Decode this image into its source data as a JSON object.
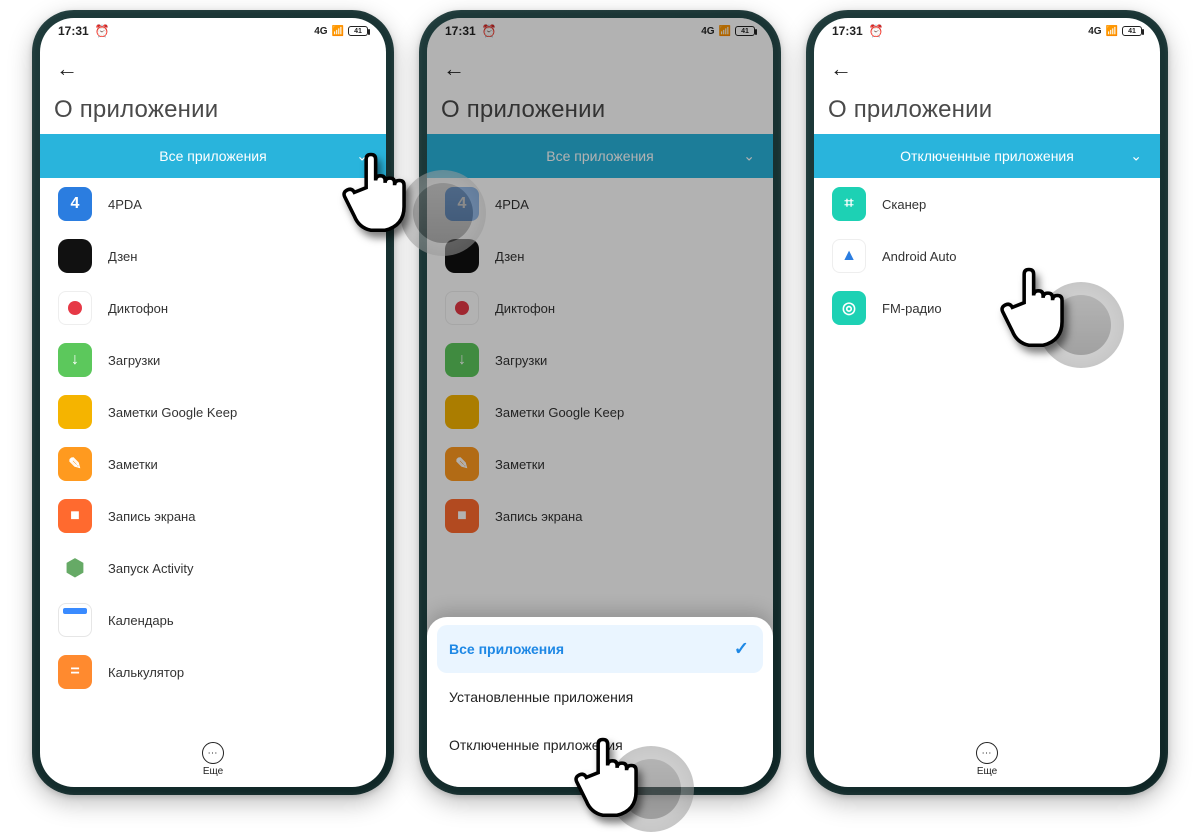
{
  "status": {
    "time": "17:31",
    "battery": "41",
    "network": "4G"
  },
  "header": {
    "title": "О приложении"
  },
  "filter": {
    "all": "Все приложения",
    "disabled": "Отключенные приложения"
  },
  "apps_all": [
    {
      "name": "4PDA",
      "icon": "ic-4pda",
      "glyph": "4"
    },
    {
      "name": "Дзен",
      "icon": "ic-dzen",
      "glyph": ""
    },
    {
      "name": "Диктофон",
      "icon": "ic-dict",
      "glyph": ""
    },
    {
      "name": "Загрузки",
      "icon": "ic-down",
      "glyph": "↓"
    },
    {
      "name": "Заметки Google Keep",
      "icon": "ic-keep",
      "glyph": ""
    },
    {
      "name": "Заметки",
      "icon": "ic-notes",
      "glyph": "✎"
    },
    {
      "name": "Запись экрана",
      "icon": "ic-rec",
      "glyph": "■"
    },
    {
      "name": "Запуск Activity",
      "icon": "ic-activity",
      "glyph": "⬢"
    },
    {
      "name": "Календарь",
      "icon": "ic-cal",
      "glyph": ""
    },
    {
      "name": "Калькулятор",
      "icon": "ic-calc",
      "glyph": "="
    }
  ],
  "apps_all_short": [
    {
      "name": "4PDA",
      "icon": "ic-4pda",
      "glyph": "4"
    },
    {
      "name": "Дзен",
      "icon": "ic-dzen",
      "glyph": ""
    },
    {
      "name": "Диктофон",
      "icon": "ic-dict",
      "glyph": ""
    },
    {
      "name": "Загрузки",
      "icon": "ic-down",
      "glyph": "↓"
    },
    {
      "name": "Заметки Google Keep",
      "icon": "ic-keep",
      "glyph": ""
    },
    {
      "name": "Заметки",
      "icon": "ic-notes",
      "glyph": "✎"
    },
    {
      "name": "Запись экрана",
      "icon": "ic-rec",
      "glyph": "■"
    }
  ],
  "apps_disabled": [
    {
      "name": "Сканер",
      "icon": "ic-scan",
      "glyph": "⌗"
    },
    {
      "name": "Android Auto",
      "icon": "ic-aauto",
      "glyph": "▲"
    },
    {
      "name": "FM-радио",
      "icon": "ic-radio",
      "glyph": "◎"
    }
  ],
  "sheet": {
    "opt1": "Все приложения",
    "opt2": "Установленные приложения",
    "opt3": "Отключенные приложения"
  },
  "more": {
    "label": "Еще"
  }
}
